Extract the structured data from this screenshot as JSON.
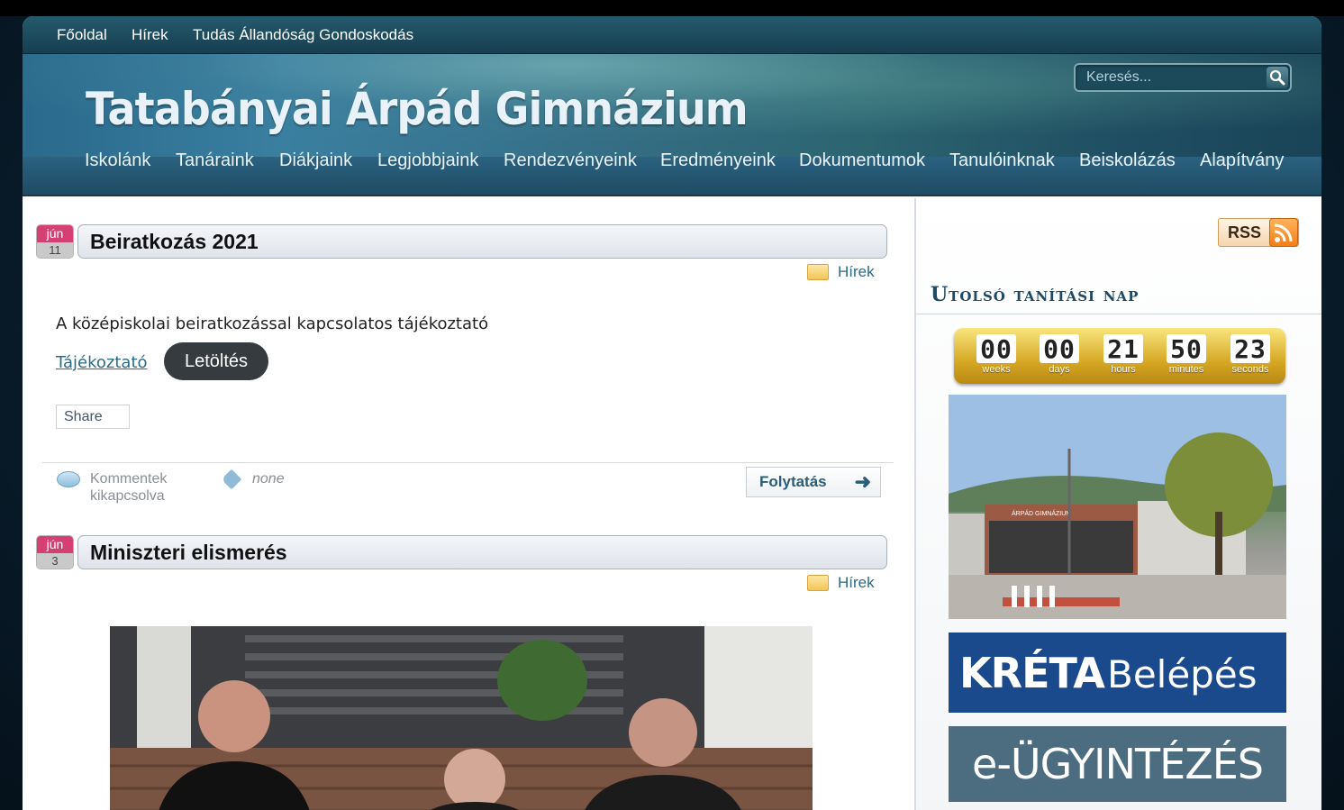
{
  "top_nav": [
    "Főoldal",
    "Hírek",
    "Tudás Állandóság Gondoskodás"
  ],
  "site_title": "Tatabányai Árpád Gimnázium",
  "search": {
    "placeholder": "Keresés..."
  },
  "main_nav": [
    "Iskolánk",
    "Tanáraink",
    "Diákjaink",
    "Legjobbjaink",
    "Rendezvényeink",
    "Eredményeink",
    "Dokumentumok",
    "Tanulóinknak",
    "Beiskolázás",
    "Alapítvány"
  ],
  "posts": [
    {
      "month": "jún",
      "day": "11",
      "title": "Beiratkozás 2021",
      "category": "Hírek",
      "text": "A középiskolai beiratkozással kapcsolatos tájékoztató",
      "link": "Tájékoztató",
      "download_button": "Letöltés",
      "share": "Share",
      "comments": "Kommentek kikapcsolva",
      "tags": "none",
      "more": "Folytatás"
    },
    {
      "month": "jún",
      "day": "3",
      "title": "Miniszteri elismerés",
      "category": "Hírek"
    }
  ],
  "sidebar": {
    "rss": "RSS",
    "widget_title": "Utolsó tanítási nap",
    "countdown": [
      {
        "value": "00",
        "label": "weeks"
      },
      {
        "value": "00",
        "label": "days"
      },
      {
        "value": "21",
        "label": "hours"
      },
      {
        "value": "50",
        "label": "minutes"
      },
      {
        "value": "23",
        "label": "seconds"
      }
    ],
    "school_sign": "ÁRPÁD GIMNÁZIUM",
    "kreta_logo": "KRÉTA",
    "kreta_text": "Belépés",
    "eugy": "e-ÜGYINTÉZÉS"
  }
}
